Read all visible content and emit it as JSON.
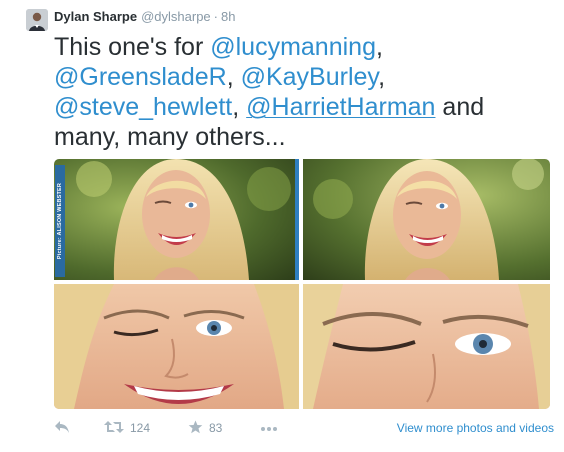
{
  "author": {
    "name": "Dylan Sharpe",
    "handle": "@dylsharpe",
    "separator": "·",
    "time": "8h"
  },
  "tweet": {
    "t1": "This one's for ",
    "m1": "@lucymanning",
    "t2": ",",
    "m2": "@GreensladeR",
    "t3": ", ",
    "m3": "@KayBurley",
    "t4": ",",
    "m4": "@steve_hewlett",
    "t5": ", ",
    "m5": "@HarrietHarman",
    "t6": " and",
    "t7": "many, many others..."
  },
  "media": {
    "photo_credit": "Picture: ALISON WEBSTER"
  },
  "actions": {
    "retweet_count": "124",
    "favorite_count": "83",
    "view_more_label": "View more photos and videos"
  },
  "colors": {
    "link": "#2f8ece",
    "muted": "#8899a6",
    "action_icon": "#aab8c2",
    "frame_blue": "#2f7fc0"
  },
  "icons": {
    "reply": "reply-icon",
    "retweet": "retweet-icon",
    "favorite": "star-icon",
    "more": "more-dots-icon"
  }
}
